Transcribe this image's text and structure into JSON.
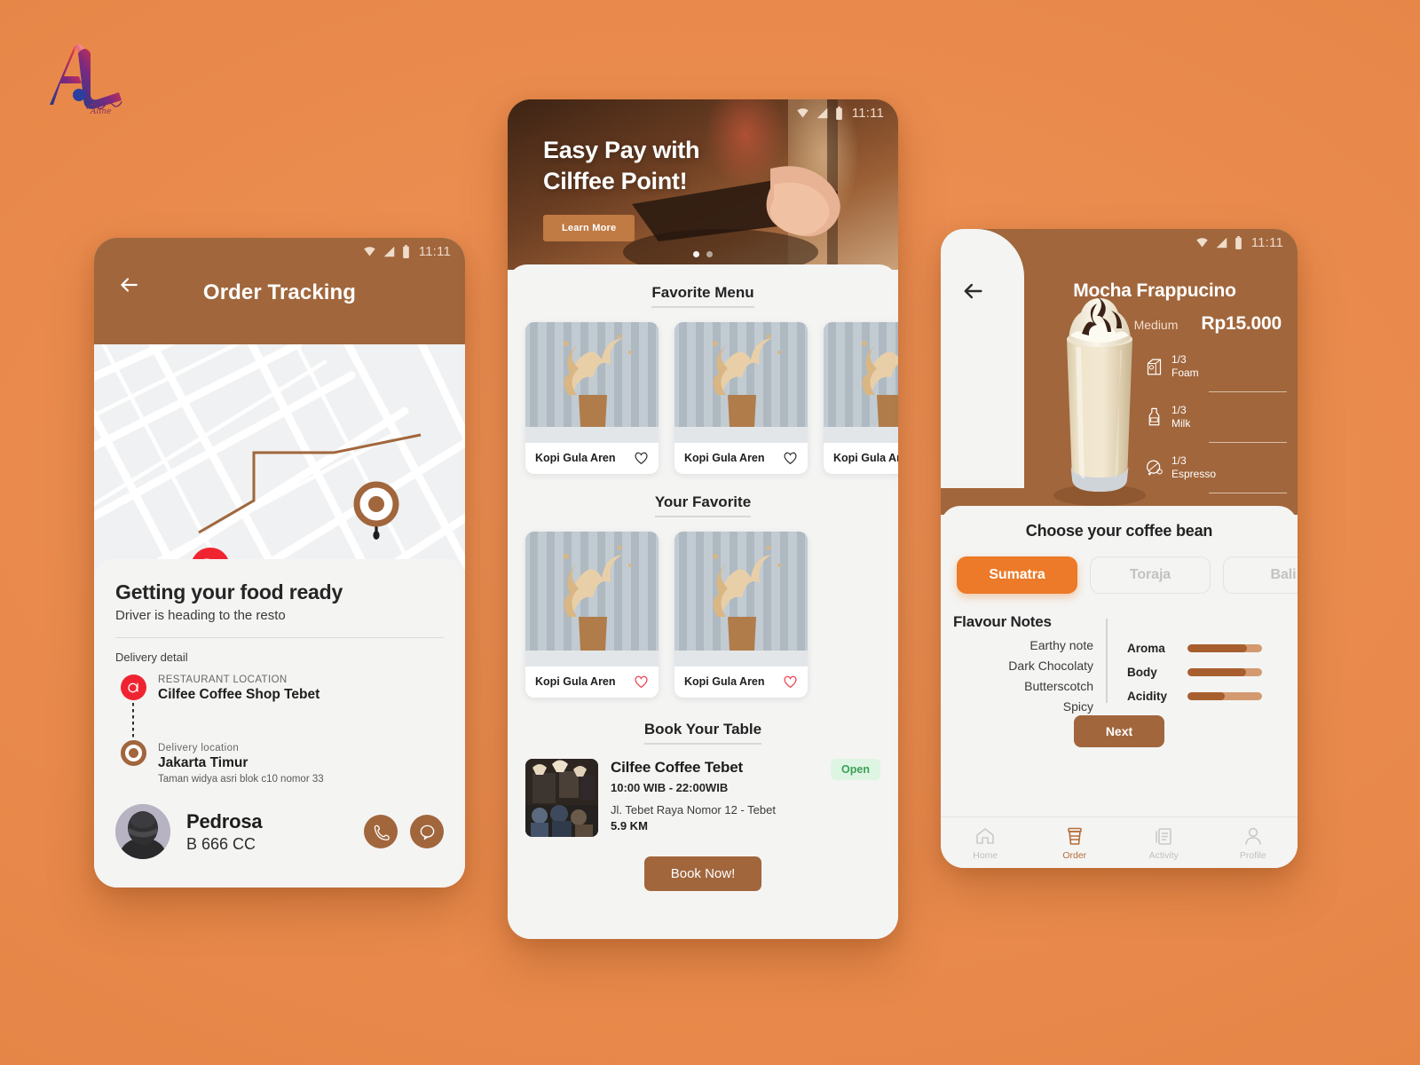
{
  "brand": {
    "logo_mark": "AL",
    "logo_script": "Aline"
  },
  "status_bar": {
    "time": "11:11",
    "icons": [
      "wifi-icon",
      "signal-icon",
      "battery-icon"
    ]
  },
  "colors": {
    "background": "#e98a4c",
    "brown": "#a1663c",
    "accent_orange": "#ec7a28",
    "red_pin": "#f02430",
    "open_green": "#3aa157",
    "open_green_bg": "#dff5e3"
  },
  "phone1": {
    "title": "Order Tracking",
    "back_icon": "arrow-left-icon",
    "map": {
      "restaurant_marker": "restaurant-pin-icon",
      "destination_marker": "destination-pin-icon"
    },
    "status_heading": "Getting your food ready",
    "status_sub": "Driver is heading to the resto",
    "delivery_detail_label": "Delivery detail",
    "steps": [
      {
        "label": "RESTAURANT LOCATION",
        "value": "Cilfee Coffee Shop Tebet",
        "sub": ""
      },
      {
        "label": "Delivery location",
        "value": "Jakarta Timur",
        "sub": "Taman widya asri blok c10 nomor 33"
      }
    ],
    "driver": {
      "name": "Pedrosa",
      "plate": "B 666 CC",
      "avatar": "driver-avatar"
    },
    "actions": [
      {
        "name": "call-button",
        "icon": "phone-icon"
      },
      {
        "name": "chat-button",
        "icon": "chat-bubble-icon"
      }
    ]
  },
  "phone2": {
    "hero": {
      "line1": "Easy Pay with",
      "line2": "Cilffee Point!",
      "cta": "Learn More",
      "dots": 2,
      "active_dot": 0
    },
    "sections": [
      {
        "title": "Favorite Menu"
      },
      {
        "title": "Your Favorite"
      },
      {
        "title": "Book Your Table"
      }
    ],
    "favorite_menu": [
      {
        "name": "Kopi Gula Aren",
        "favorited": false
      },
      {
        "name": "Kopi Gula Aren",
        "favorited": false
      },
      {
        "name": "Kopi Gula Aren",
        "favorited": false
      }
    ],
    "your_favorite": [
      {
        "name": "Kopi Gula Aren",
        "favorited": true
      },
      {
        "name": "Kopi Gula Aren",
        "favorited": true
      }
    ],
    "restaurant": {
      "name": "Cilfee Coffee Tebet",
      "hours": "10:00 WIB - 22:00WIB",
      "address": "Jl. Tebet Raya Nomor 12 - Tebet",
      "distance": "5.9 KM",
      "status": "Open"
    },
    "book_button": "Book Now!"
  },
  "phone3": {
    "title": "Mocha Frappucino",
    "back_icon": "arrow-left-icon",
    "size": "Medium",
    "price": "Rp15.000",
    "ingredients": [
      {
        "amount": "1/3",
        "name": "Foam",
        "icon": "foam-carton-icon"
      },
      {
        "amount": "1/3",
        "name": "Milk",
        "icon": "milk-bottle-icon"
      },
      {
        "amount": "1/3",
        "name": "Espresso",
        "icon": "coffee-bean-icon"
      }
    ],
    "choose_heading": "Choose your coffee bean",
    "beans": [
      {
        "label": "Sumatra",
        "selected": true
      },
      {
        "label": "Toraja",
        "selected": false
      },
      {
        "label": "Bali",
        "selected": false
      }
    ],
    "flavour_title": "Flavour Notes",
    "flavour_notes": [
      "Earthy note",
      "Dark Chocolaty",
      "Butterscotch",
      "Spicy"
    ],
    "metrics": [
      {
        "name": "Aroma",
        "value": 80
      },
      {
        "name": "Body",
        "value": 78
      },
      {
        "name": "Acidity",
        "value": 50
      }
    ],
    "next_button": "Next",
    "nav": [
      {
        "label": "Home",
        "icon": "home-icon",
        "active": false
      },
      {
        "label": "Order",
        "icon": "coffee-cup-icon",
        "active": true
      },
      {
        "label": "Activity",
        "icon": "document-icon",
        "active": false
      },
      {
        "label": "Profile",
        "icon": "person-icon",
        "active": false
      }
    ]
  }
}
